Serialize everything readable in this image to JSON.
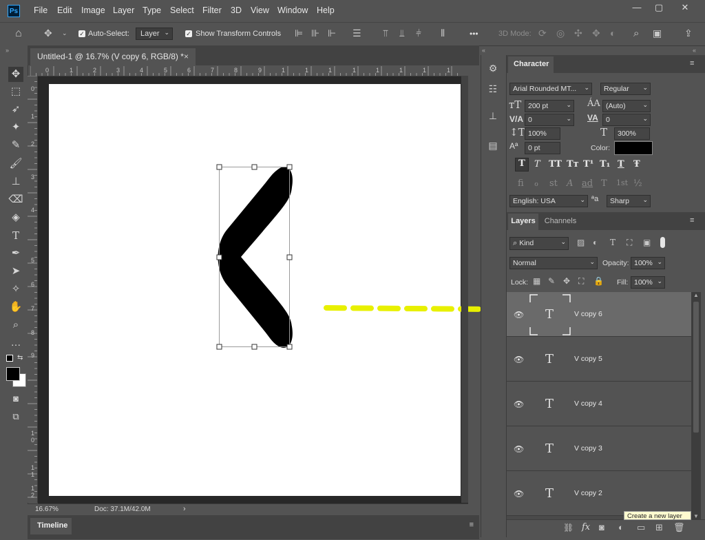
{
  "app": {
    "logo_text": "Ps",
    "accent": "#31a8ff"
  },
  "menubar": {
    "items": [
      "File",
      "Edit",
      "Image",
      "Layer",
      "Type",
      "Select",
      "Filter",
      "3D",
      "View",
      "Window",
      "Help"
    ],
    "window_controls": {
      "minimize": "—",
      "restore": "▢",
      "close": "✕"
    }
  },
  "options": {
    "auto_select_label": "Auto-Select:",
    "auto_select_checked": true,
    "auto_select_value": "Layer",
    "show_transform_label": "Show Transform Controls",
    "show_transform_checked": true,
    "more": "•••",
    "mode_3d_label": "3D Mode:"
  },
  "document": {
    "tab_title": "Untitled-1 @ 16.7% (V copy 6, RGB/8) *",
    "close": "×",
    "zoom": "16.67%",
    "doc_info": "Doc: 37.1M/42.0M",
    "ruler_h": [
      "0",
      "1",
      "2",
      "3",
      "4",
      "5",
      "6",
      "7",
      "8",
      "9",
      "1",
      "1",
      "1",
      "1",
      "1",
      "1",
      "1",
      "1"
    ],
    "ruler_v": [
      "0",
      "1",
      "2",
      "3",
      "4",
      "5",
      "6",
      "7",
      "8",
      "9",
      "1",
      "0",
      "1",
      "1",
      "1",
      "2"
    ]
  },
  "timeline": {
    "label": "Timeline"
  },
  "character": {
    "tab_label": "Character",
    "font_family": "Arial Rounded MT...",
    "font_style": "Regular",
    "font_size": "200 pt",
    "leading": "(Auto)",
    "kerning": "0",
    "tracking": "0",
    "vertical_scale": "100%",
    "horizontal_scale": "300%",
    "baseline_shift": "0 pt",
    "color_label": "Color:",
    "color_value": "#000000",
    "language": "English: USA",
    "antialias": "Sharp",
    "style_glyphs": [
      "T",
      "T",
      "TT",
      "Tт",
      "T¹",
      "T₁",
      "T",
      "Ŧ"
    ],
    "opentype_glyphs": [
      "ﬁ",
      "ℴ",
      "st",
      "A",
      "ad",
      "T",
      "1st",
      "½"
    ]
  },
  "layers": {
    "tab_label": "Layers",
    "channels_label": "Channels",
    "filter_kind": "Kind",
    "blend_mode": "Normal",
    "opacity_label": "Opacity:",
    "opacity": "100%",
    "lock_label": "Lock:",
    "fill_label": "Fill:",
    "fill": "100%",
    "items": [
      {
        "name": "V copy 6",
        "selected": true
      },
      {
        "name": "V copy 5",
        "selected": false
      },
      {
        "name": "V copy 4",
        "selected": false
      },
      {
        "name": "V copy 3",
        "selected": false
      },
      {
        "name": "V copy 2",
        "selected": false
      }
    ],
    "tooltip": "Create a new layer"
  },
  "colors": {
    "annotation_arrow": "#e8f000",
    "selected_layer_bg": "#6a6a6a",
    "canvas_bg": "#ffffff"
  }
}
